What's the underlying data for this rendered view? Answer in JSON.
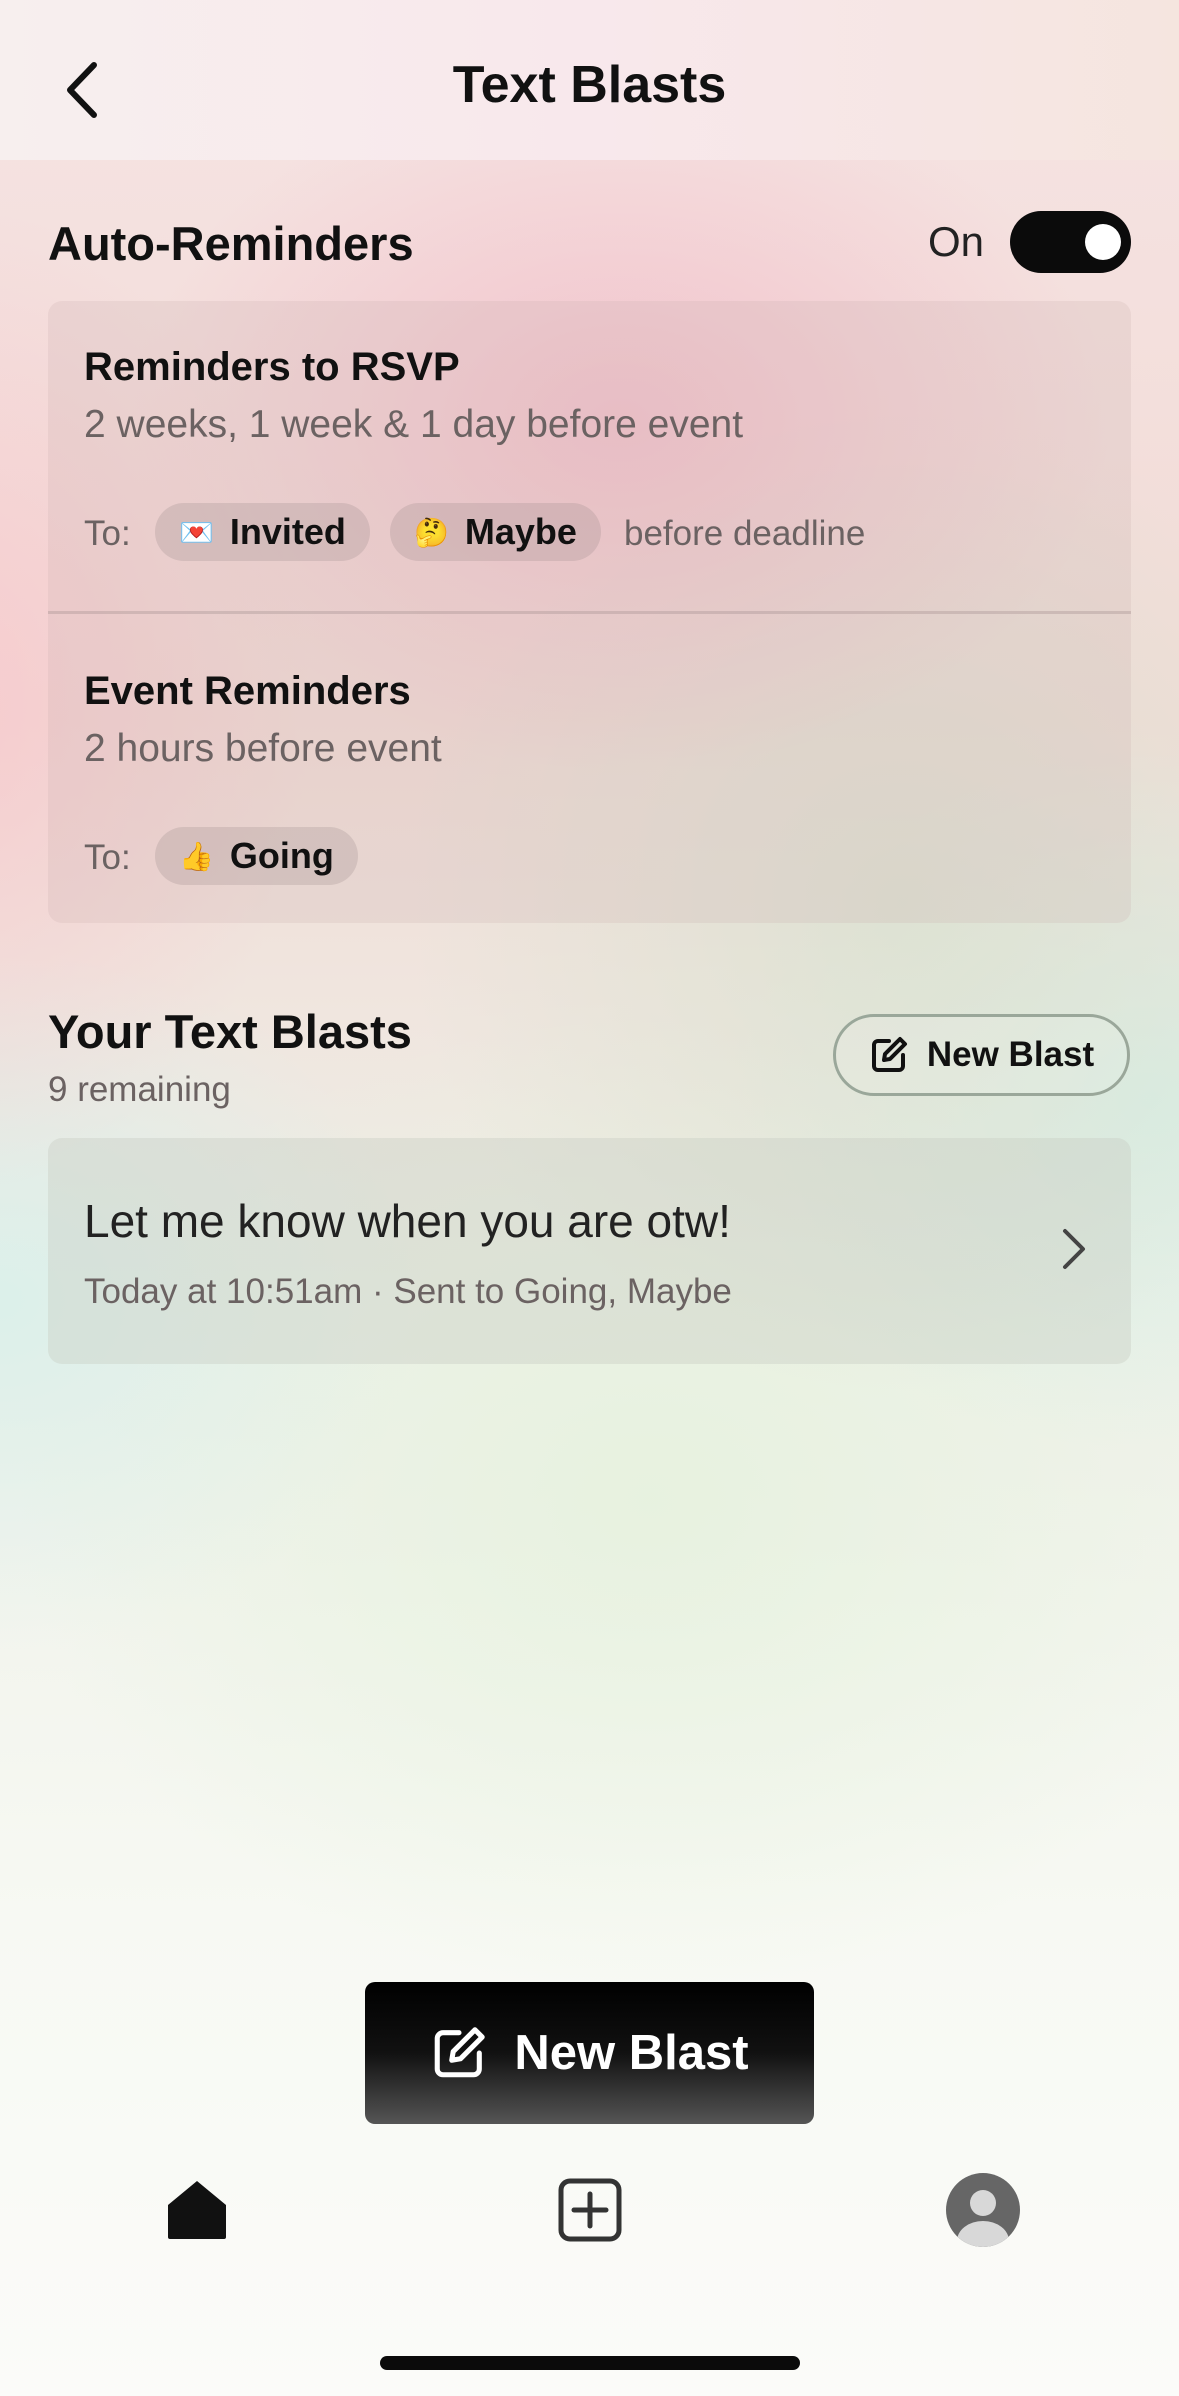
{
  "header": {
    "title": "Text Blasts"
  },
  "auto_reminders": {
    "title": "Auto-Reminders",
    "toggle_label": "On",
    "toggle_on": true,
    "rsvp": {
      "title": "Reminders to RSVP",
      "schedule": "2 weeks, 1 week & 1 day before event",
      "to_label": "To:",
      "chips": [
        {
          "emoji": "💌",
          "label": "Invited"
        },
        {
          "emoji": "🤔",
          "label": "Maybe"
        }
      ],
      "suffix": "before deadline"
    },
    "event": {
      "title": "Event Reminders",
      "schedule": "2 hours before event",
      "to_label": "To:",
      "chips": [
        {
          "emoji": "👍",
          "label": "Going"
        }
      ]
    }
  },
  "blasts": {
    "title": "Your Text Blasts",
    "remaining": "9 remaining",
    "new_button": "New Blast",
    "items": [
      {
        "message": "Let me know when you are otw!",
        "meta": "Today at 10:51am · Sent to Going, Maybe"
      }
    ]
  },
  "floating_button": {
    "label": "New Blast"
  },
  "colors": {
    "accent": "#0b0b0b",
    "muted_text": "#6b6262"
  },
  "icons": {
    "back": "chevron-left-icon",
    "edit": "edit-icon",
    "chevron": "chevron-right-icon",
    "home": "home-icon",
    "add": "plus-square-icon",
    "profile": "avatar-icon"
  }
}
